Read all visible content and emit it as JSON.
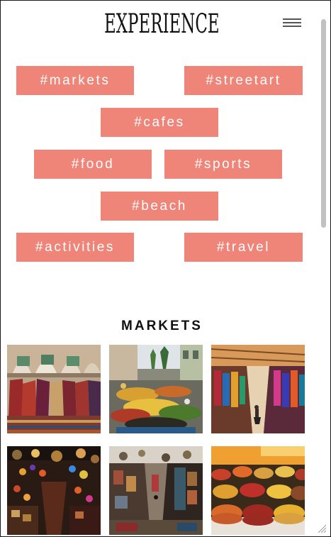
{
  "header": {
    "logo_text": "EXPERIENCE",
    "menu_icon": "hamburger-menu-icon"
  },
  "tags": [
    {
      "label": "#markets"
    },
    {
      "label": "#streetart"
    },
    {
      "label": "#cafes"
    },
    {
      "label": "#food"
    },
    {
      "label": "#sports"
    },
    {
      "label": "#beach"
    },
    {
      "label": "#activities"
    },
    {
      "label": "#travel"
    }
  ],
  "markets": {
    "title": "MARKETS",
    "photos": [
      {
        "subject": "rug-and-carpet-stall"
      },
      {
        "subject": "fruit-and-vegetable-street-market"
      },
      {
        "subject": "covered-bazaar-alley-with-clothes"
      },
      {
        "subject": "lantern-shop-interior"
      },
      {
        "subject": "narrow-lantern-souk-alley"
      },
      {
        "subject": "spice-sacks-market"
      }
    ]
  },
  "colors": {
    "tag_background": "#ef8479",
    "tag_text": "#ffffff",
    "heading_text": "#111111",
    "page_background": "#ffffff"
  }
}
